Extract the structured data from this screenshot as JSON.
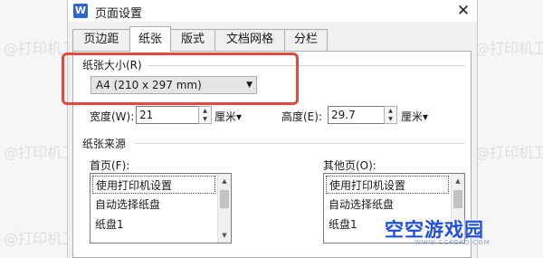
{
  "window": {
    "app_icon": "W",
    "title": "页面设置",
    "close_glyph": "✕"
  },
  "tabs": [
    {
      "label": "页边距",
      "active": false
    },
    {
      "label": "纸张",
      "active": true
    },
    {
      "label": "版式",
      "active": false
    },
    {
      "label": "文档网格",
      "active": false
    },
    {
      "label": "分栏",
      "active": false
    }
  ],
  "paper_size": {
    "group_label": "纸张大小(R)",
    "selected": "A4 (210 x 297 mm)",
    "highlight_color": "#e04a3f"
  },
  "width": {
    "label": "宽度(W):",
    "value": "21",
    "unit": "厘米▾"
  },
  "height": {
    "label": "高度(E):",
    "value": "29.7",
    "unit": "厘米▾"
  },
  "paper_source": {
    "group_label": "纸张来源",
    "first_page": {
      "label": "首页(F):",
      "items": [
        "使用打印机设置",
        "自动选择纸盘",
        "纸盘1"
      ]
    },
    "other_pages": {
      "label": "其他页(O):",
      "items": [
        "使用打印机设置",
        "自动选择纸盘",
        "纸盘1"
      ]
    }
  },
  "watermark": {
    "text": "@打印机卫士"
  },
  "logo": {
    "text": "空空游戏园",
    "sub": "WWW.CCKOKO.COM"
  }
}
